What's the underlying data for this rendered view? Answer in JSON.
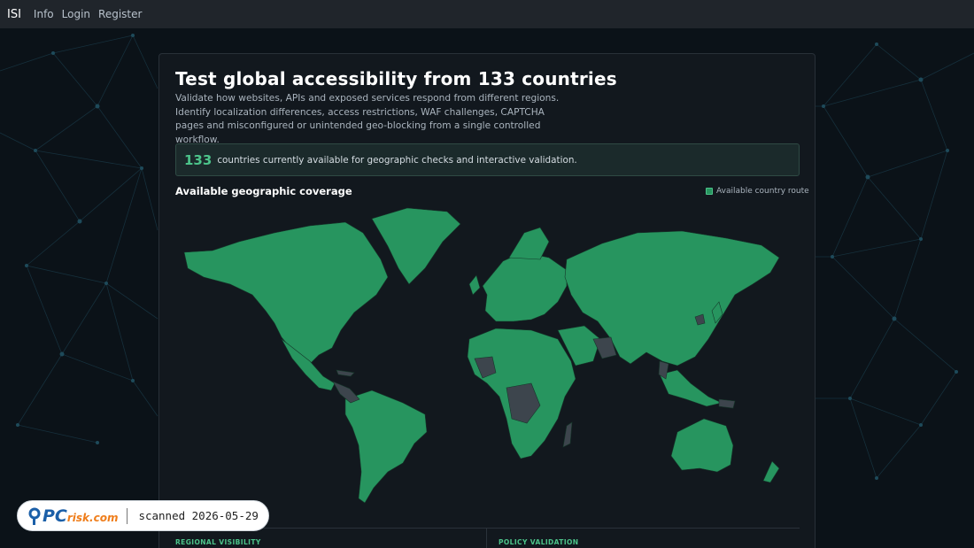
{
  "nav": {
    "brand": "ISI",
    "links": [
      "Info",
      "Login",
      "Register"
    ]
  },
  "hero": {
    "title": "Test global accessibility from 133 countries",
    "description": "Validate how websites, APIs and exposed services respond from different regions. Identify localization differences, access restrictions, WAF challenges, CAPTCHA pages and misconfigured or unintended geo-blocking from a single controlled workflow."
  },
  "stat": {
    "count": "133",
    "text": "countries currently available for geographic checks and interactive validation."
  },
  "coverage": {
    "title": "Available geographic coverage",
    "legend_label": "Available country route"
  },
  "sections": {
    "left_label": "REGIONAL VISIBILITY",
    "right_label": "POLICY VALIDATION"
  },
  "watermark": {
    "logo_pc": "PC",
    "logo_risk": "risk.com",
    "text": "scanned 2026-05-29"
  },
  "colors": {
    "available": "#27955f",
    "unavailable": "#3d454d",
    "accent": "#4cc38a"
  }
}
